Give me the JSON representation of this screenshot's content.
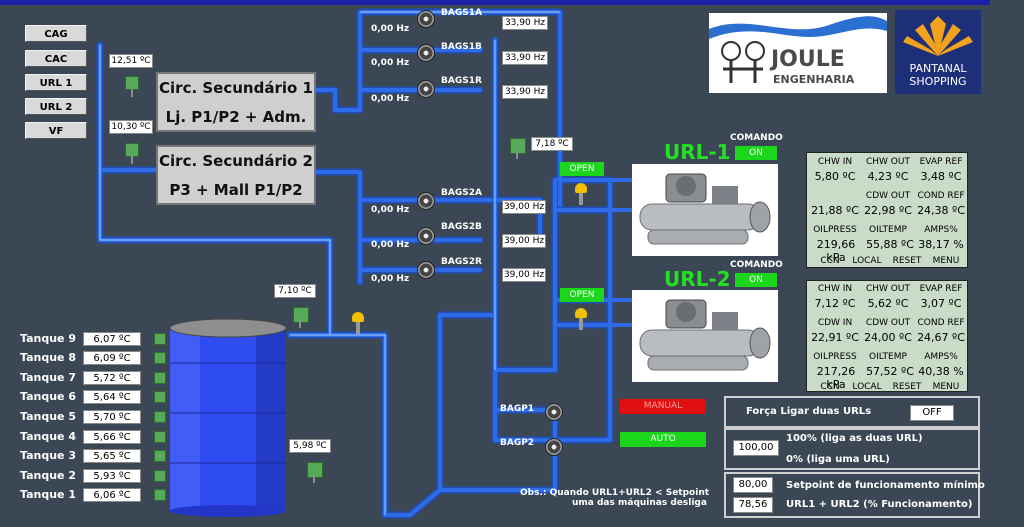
{
  "nav": [
    "CAG",
    "CAC",
    "URL 1",
    "URL 2",
    "VF"
  ],
  "circuits": {
    "sec1": {
      "line1": "Circ. Secundário 1",
      "line2": "Lj. P1/P2 + Adm."
    },
    "sec2": {
      "line1": "Circ. Secundário 2",
      "line2": "P3 + Mall P1/P2"
    }
  },
  "temps": {
    "t1": "12,51 ºC",
    "t2": "10,30 ºC",
    "header": "7,18 ºC",
    "tank_in": "7,10 ºC",
    "tank_out": "5,98 ºC"
  },
  "pumps_sec1": [
    {
      "name": "BAGS1A",
      "hz_left": "0,00 Hz",
      "hz_right": "33,90 Hz"
    },
    {
      "name": "BAGS1B",
      "hz_left": "0,00 Hz",
      "hz_right": "33,90 Hz"
    },
    {
      "name": "BAGS1R",
      "hz_left": "0,00 Hz",
      "hz_right": "33,90 Hz"
    }
  ],
  "pumps_sec2": [
    {
      "name": "BAGS2A",
      "hz_left": "0,00 Hz",
      "hz_right": "39,00 Hz"
    },
    {
      "name": "BAGS2B",
      "hz_left": "0,00 Hz",
      "hz_right": "39,00 Hz"
    },
    {
      "name": "BAGS2R",
      "hz_left": "0,00 Hz",
      "hz_right": "39,00 Hz"
    }
  ],
  "primary_pumps": [
    "BAGP1",
    "BAGP2"
  ],
  "valves": {
    "v1": "OPEN",
    "v2": "OPEN"
  },
  "url1": {
    "title": "URL-1",
    "comando_label": "COMANDO",
    "comando": "ON",
    "h1": [
      "CHW IN",
      "CHW OUT",
      "EVAP REF"
    ],
    "v1": [
      "5,80 ºC",
      "4,23 ºC",
      "3,48 ºC"
    ],
    "h2": [
      "",
      "CDW OUT",
      "COND REF"
    ],
    "v2": [
      "21,88 ºC",
      "22,98 ºC",
      "24,38 ºC"
    ],
    "h3": [
      "OILPRESS",
      "OILTEMP",
      "AMPS%"
    ],
    "v3": [
      "219,66 kPa",
      "55,88 ºC",
      "38,17 %"
    ],
    "foot": [
      "CCN",
      "LOCAL",
      "RESET",
      "MENU"
    ]
  },
  "url2": {
    "title": "URL-2",
    "comando_label": "COMANDO",
    "comando": "ON",
    "h1": [
      "CHW IN",
      "CHW OUT",
      "EVAP REF"
    ],
    "v1": [
      "7,12 ºC",
      "5,62 ºC",
      "3,07 ºC"
    ],
    "h2": [
      "CDW IN",
      "CDW OUT",
      "COND REF"
    ],
    "v2": [
      "22,91 ºC",
      "24,00 ºC",
      "24,67 ºC"
    ],
    "h3": [
      "OILPRESS",
      "OILTEMP",
      "AMPS%"
    ],
    "v3": [
      "217,26 kPa",
      "57,52 ºC",
      "40,38 %"
    ],
    "foot": [
      "CCN",
      "LOCAL",
      "RESET",
      "MENU"
    ]
  },
  "mode": {
    "manual": "MANUAL",
    "auto": "AUTO"
  },
  "tanks": [
    {
      "label": "Tanque 9",
      "value": "6,07 ºC"
    },
    {
      "label": "Tanque 8",
      "value": "6,09 ºC"
    },
    {
      "label": "Tanque 7",
      "value": "5,72 ºC"
    },
    {
      "label": "Tanque 6",
      "value": "5,64 ºC"
    },
    {
      "label": "Tanque 5",
      "value": "5,70 ºC"
    },
    {
      "label": "Tanque 4",
      "value": "5,66 ºC"
    },
    {
      "label": "Tanque 3",
      "value": "5,65 ºC"
    },
    {
      "label": "Tanque 2",
      "value": "5,93 ºC"
    },
    {
      "label": "Tanque 1",
      "value": "6,06 ºC"
    }
  ],
  "controls": {
    "force_label": "Força Ligar duas URLs",
    "force_value": "OFF",
    "pct_value": "100,00",
    "pct_line1": "100% (liga as duas URL)",
    "pct_line2": "0% (liga uma URL)",
    "setpoint_value": "80,00",
    "setpoint_label": "Setpoint de funcionamento mínimo",
    "sum_value": "78,56",
    "sum_label": "URL1 + URL2 (% Funcionamento)"
  },
  "obs": {
    "line1": "Obs.: Quando URL1+URL2 < Setpoint",
    "line2": "uma das máquinas desliga"
  },
  "logos": {
    "joule_line1": "JOULE",
    "joule_line2": "ENGENHARIA",
    "pantanal_line1": "PANTANAL",
    "pantanal_line2": "SHOPPING"
  },
  "colors": {
    "background": "#3b4754",
    "pipe": "#2f6be6",
    "status_on": "#1bd61b",
    "status_manual": "#e01010",
    "chiller_title": "#23e023"
  }
}
